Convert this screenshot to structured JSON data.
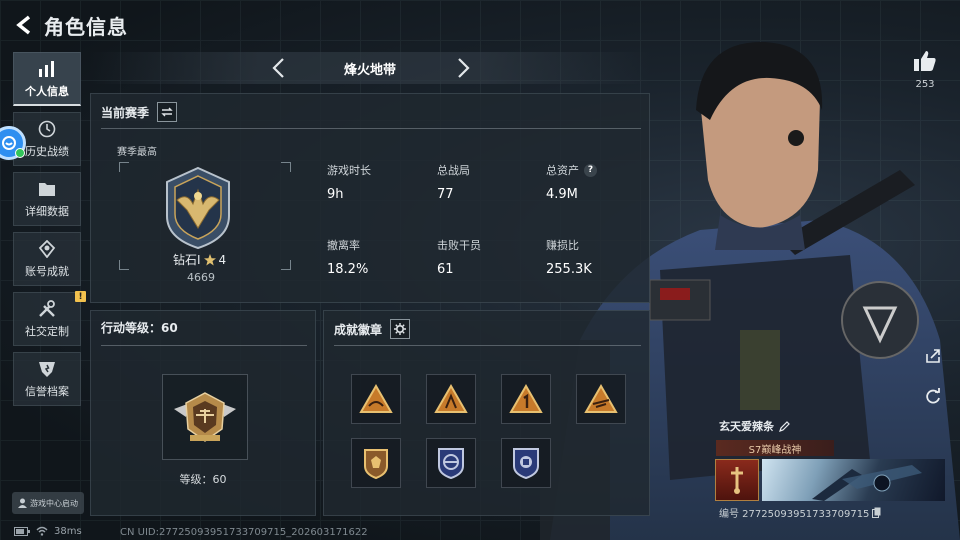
{
  "header": {
    "title": "角色信息"
  },
  "sidebar": {
    "items": [
      {
        "label": "个人信息",
        "icon": "bar-chart-icon",
        "active": true
      },
      {
        "label": "历史战绩",
        "icon": "clock-icon"
      },
      {
        "label": "详细数据",
        "icon": "folder-icon"
      },
      {
        "label": "账号成就",
        "icon": "achievement-icon"
      },
      {
        "label": "社交定制",
        "icon": "tools-icon",
        "alert": "!"
      },
      {
        "label": "信誉档案",
        "icon": "shield-icon"
      }
    ],
    "game_center": "游戏中心启动"
  },
  "status": {
    "ping": "38ms",
    "uid": "CN UID:27725093951733709715_202603171622"
  },
  "season_nav": {
    "title": "烽火地带"
  },
  "current_season": {
    "heading": "当前赛季",
    "best_label": "赛季最高",
    "rank_name": "钻石Ⅰ",
    "rank_stars": "4",
    "rank_score": "4669",
    "stats": [
      {
        "key": "游戏时长",
        "value": "9h"
      },
      {
        "key": "总战局",
        "value": "77"
      },
      {
        "key": "总资产",
        "value": "4.9M",
        "help": "?"
      },
      {
        "key": "撤离率",
        "value": "18.2%"
      },
      {
        "key": "击败干员",
        "value": "61"
      },
      {
        "key": "赚损比",
        "value": "255.3K"
      }
    ]
  },
  "level_panel": {
    "heading": "行动等级：60",
    "level_text": "等级：60"
  },
  "medals_panel": {
    "heading": "成就徽章"
  },
  "profile": {
    "likes": "253",
    "player_name": "玄天爱辣条",
    "title_tag": "S7巅峰战神",
    "card_id": "编号 27725093951733709715"
  },
  "colors": {
    "accent_gold": "#c9a45a",
    "alert_yellow": "#f2c14e",
    "title_tag_red": "#5a2a20"
  }
}
